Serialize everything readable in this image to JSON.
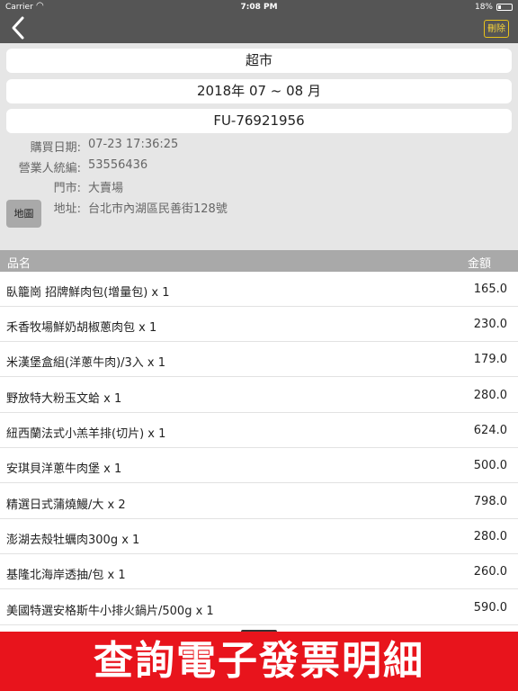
{
  "status": {
    "carrier": "Carrier",
    "time": "7:08 PM",
    "battery": "18%"
  },
  "nav": {
    "back_icon": "chevron-left-icon",
    "delete_label": "刪除"
  },
  "fields": {
    "store_type": "超市",
    "period": "2018年 07 ~ 08 月",
    "invoice_no": "FU-76921956"
  },
  "info": [
    {
      "label": "購買日期:",
      "value": "07-23 17:36:25"
    },
    {
      "label": "營業人統編:",
      "value": "53556436"
    },
    {
      "label": "門市:",
      "value": "大賣場"
    },
    {
      "label": "地址:",
      "value": "台北市內湖區民善街128號"
    }
  ],
  "map_button": "地圖",
  "table": {
    "headers": [
      "品名",
      "金額"
    ],
    "rows": [
      {
        "name": "臥籠崗 招牌鮮肉包(增量包) x 1",
        "amount": "165.0"
      },
      {
        "name": "禾香牧場鮮奶胡椒蔥肉包 x 1",
        "amount": "230.0"
      },
      {
        "name": "米漢堡盒組(洋蔥牛肉)/3入 x 1",
        "amount": "179.0"
      },
      {
        "name": "野放特大粉玉文蛤 x 1",
        "amount": "280.0"
      },
      {
        "name": "紐西蘭法式小羔羊排(切片) x 1",
        "amount": "624.0"
      },
      {
        "name": "安琪貝洋蔥牛肉堡 x 1",
        "amount": "500.0"
      },
      {
        "name": "精選日式蒲燒鰻/大 x 2",
        "amount": "798.0"
      },
      {
        "name": "澎湖去殼牡蠣肉300g x 1",
        "amount": "280.0"
      },
      {
        "name": "基隆北海岸透抽/包 x 1",
        "amount": "260.0"
      },
      {
        "name": "美國特選安格斯牛小排火鍋片/500g x 1",
        "amount": "590.0"
      }
    ]
  },
  "banner": "查詢電子發票明細"
}
